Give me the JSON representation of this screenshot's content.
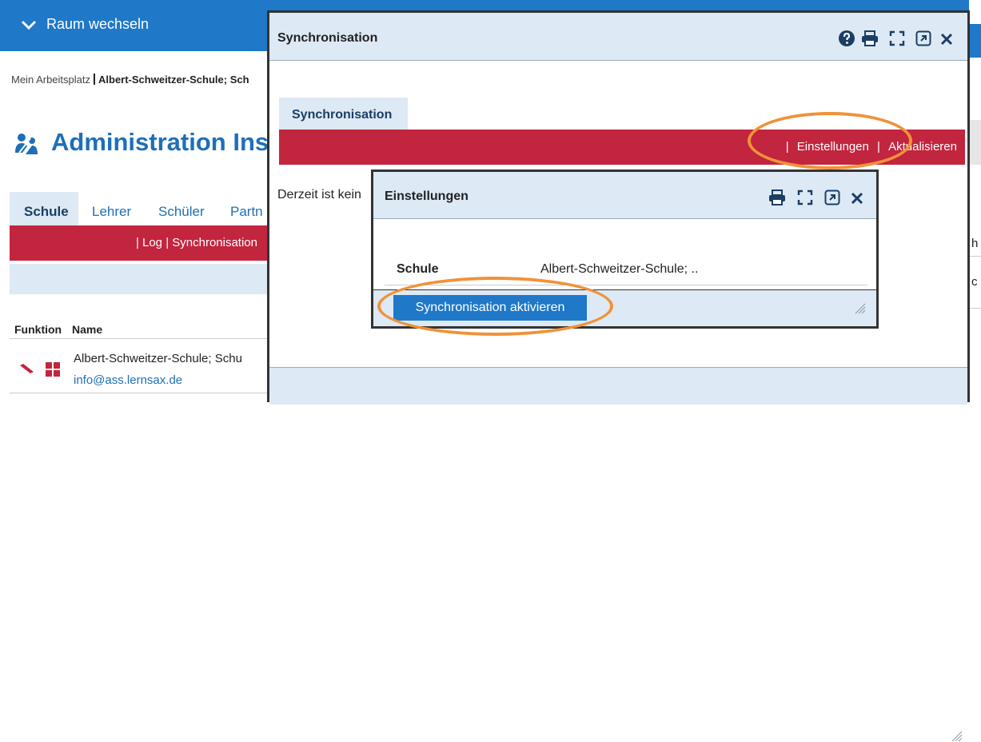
{
  "topbar": {
    "label": "Raum wechseln"
  },
  "breadcrumb": {
    "root": "Mein Arbeitsplatz",
    "current": "Albert-Schweitzer-Schule; Sch"
  },
  "page": {
    "title": "Administration Inst"
  },
  "tabs": [
    {
      "label": "Schule"
    },
    {
      "label": "Lehrer"
    },
    {
      "label": "Schüler"
    },
    {
      "label": "Partn"
    }
  ],
  "subnav": {
    "links": "| Log | Synchronisation"
  },
  "table": {
    "headers": {
      "funktion": "Funktion",
      "name": "Name"
    },
    "rows": [
      {
        "name": "Albert-Schweitzer-Schule; Schu",
        "email": "info@ass.lernsax.de"
      }
    ]
  },
  "right_fragments": {
    "c1": "h",
    "c2": "c"
  },
  "sync_dialog": {
    "title": "Synchronisation",
    "tab": "Synchronisation",
    "toolbar": {
      "sep1": "|",
      "einstellungen": "Einstellungen",
      "sep2": "|",
      "aktualisieren": "Aktualisieren"
    },
    "message": "Derzeit ist kein"
  },
  "settings_dialog": {
    "title": "Einstellungen",
    "field_label": "Schule",
    "field_value": "Albert-Schweitzer-Schule; ..",
    "button": "Synchronisation aktivieren"
  },
  "colors": {
    "primary_blue": "#1f78c8",
    "brand_red": "#c2253e",
    "panel_blue": "#dde9f4",
    "highlight_orange": "#f0923a",
    "link_blue": "#1d6fb8"
  }
}
